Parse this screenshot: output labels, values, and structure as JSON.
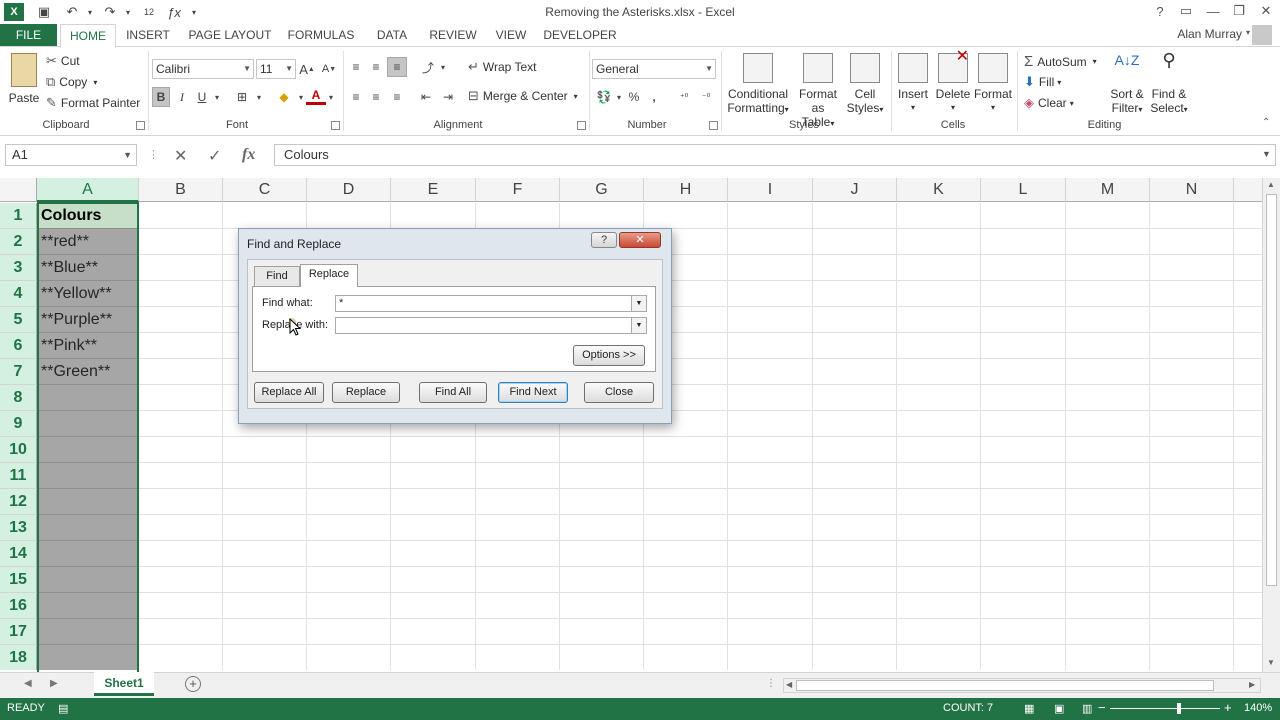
{
  "window": {
    "title": "Removing the Asterisks.xlsx - Excel",
    "help": "?",
    "minimize": "—",
    "restore": "❐",
    "close": "✕"
  },
  "qat": {
    "font_size": "12"
  },
  "tabs": [
    "FILE",
    "HOME",
    "INSERT",
    "PAGE LAYOUT",
    "FORMULAS",
    "DATA",
    "REVIEW",
    "VIEW",
    "DEVELOPER"
  ],
  "user": "Alan Murray",
  "ribbon": {
    "clipboard": {
      "paste": "Paste",
      "cut": "Cut",
      "copy": "Copy",
      "format_painter": "Format Painter",
      "label": "Clipboard"
    },
    "font": {
      "name": "Calibri",
      "size": "11",
      "bold": "B",
      "italic": "I",
      "underline": "U",
      "label": "Font"
    },
    "alignment": {
      "wrap": "Wrap Text",
      "merge": "Merge & Center",
      "label": "Alignment"
    },
    "number": {
      "format": "General",
      "percent": "%",
      "comma": ",",
      "label": "Number"
    },
    "styles": {
      "conditional": [
        "Conditional",
        "Formatting"
      ],
      "table": [
        "Format as",
        "Table"
      ],
      "cell": [
        "Cell",
        "Styles"
      ],
      "label": "Styles"
    },
    "cells": {
      "insert": "Insert",
      "delete": "Delete",
      "format": "Format",
      "label": "Cells"
    },
    "editing": {
      "autosum": "AutoSum",
      "fill": "Fill",
      "clear": "Clear",
      "sort": [
        "Sort &",
        "Filter"
      ],
      "find": [
        "Find &",
        "Select"
      ],
      "label": "Editing"
    }
  },
  "formula_bar": {
    "name_box": "A1",
    "content": "Colours"
  },
  "columns": [
    "A",
    "B",
    "C",
    "D",
    "E",
    "F",
    "G",
    "H",
    "I",
    "J",
    "K",
    "L",
    "M",
    "N"
  ],
  "rows": [
    "1",
    "2",
    "3",
    "4",
    "5",
    "6",
    "7",
    "8",
    "9",
    "10",
    "11",
    "12",
    "13",
    "14",
    "15",
    "16",
    "17",
    "18"
  ],
  "cells_a": [
    "Colours",
    "**red**",
    "**Blue**",
    "**Yellow**",
    "**Purple**",
    "**Pink**",
    "**Green**"
  ],
  "dialog": {
    "title": "Find and Replace",
    "tabs": {
      "find": "Find",
      "replace": "Replace"
    },
    "find_label": "Find what:",
    "find_value": "*",
    "replace_label": "Replace with:",
    "replace_value": "",
    "options": "Options >>",
    "buttons": {
      "replace_all": "Replace All",
      "replace": "Replace",
      "find_all": "Find All",
      "find_next": "Find Next",
      "close": "Close"
    }
  },
  "sheets": [
    "Sheet1"
  ],
  "status": {
    "ready": "READY",
    "count": "COUNT: 7",
    "zoom": "140%"
  },
  "colors": {
    "excel_green": "#217346",
    "selection_fill": "#a6a6a6"
  }
}
